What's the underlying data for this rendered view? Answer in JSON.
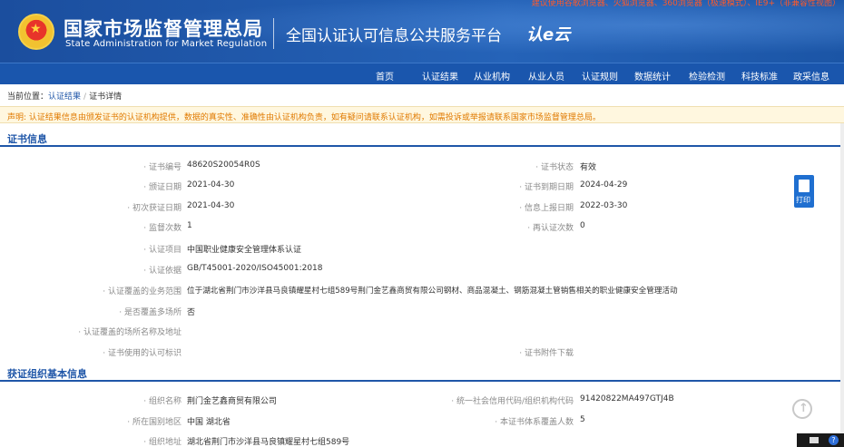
{
  "header": {
    "top_notice": "建议使用谷歌浏览器、火狐浏览器、360浏览器（极速模式）、IE9+（非兼容性视图）",
    "title_cn": "国家市场监督管理总局",
    "title_en": "State Administration  for  Market Regulation",
    "platform": "全国认证认可信息公共服务平台",
    "logo_text": "认e云"
  },
  "nav": {
    "items": [
      "首页",
      "认证结果",
      "从业机构",
      "从业人员",
      "认证规则",
      "数据统计",
      "检验检测",
      "科技标准",
      "政采信息"
    ]
  },
  "breadcrumb": {
    "prefix": "当前位置：",
    "item1": "认证结果",
    "sep": "/",
    "item2": "证书详情"
  },
  "notice": "声明: 认证结果信息由颁发证书的认证机构提供，数据的真实性、准确性由认证机构负责，如有疑问请联系认证机构，如需投诉或举报请联系国家市场监督管理总局。",
  "cert": {
    "section_title": "证书信息",
    "cert_no_label": "· 证书编号",
    "cert_no": "48620S20054R0S",
    "status_label": "· 证书状态",
    "status": "有效",
    "issue_date_label": "· 颁证日期",
    "issue_date": "2021-04-30",
    "expire_date_label": "· 证书到期日期",
    "expire_date": "2024-04-29",
    "first_date_label": "· 初次获证日期",
    "first_date": "2021-04-30",
    "report_date_label": "· 信息上报日期",
    "report_date": "2022-03-30",
    "supervision_label": "· 监督次数",
    "supervision": "1",
    "recert_label": "· 再认证次数",
    "recert": "0",
    "project_label": "· 认证项目",
    "project": "中国职业健康安全管理体系认证",
    "basis_label": "· 认证依据",
    "basis": "GB/T45001-2020/ISO45001:2018",
    "scope_label": "· 认证覆盖的业务范围",
    "scope": "位于湖北省荆门市沙洋县马良镇耀星村七组589号荆门金艺鑫商贸有限公司钢材、商品混凝土、钢筋混凝土管销售相关的职业健康安全管理活动",
    "multisite_label": "· 是否覆盖多场所",
    "multisite": "否",
    "site_names_label": "· 认证覆盖的场所名称及地址",
    "mark_label": "· 证书使用的认可标识",
    "attachment_label": "· 证书附件下载"
  },
  "org": {
    "section_title": "获证组织基本信息",
    "name_label": "· 组织名称",
    "name": "荆门金艺鑫商贸有限公司",
    "credit_label": "· 统一社会信用代码/组织机构代码",
    "credit": "91420822MA497GTJ4B",
    "region_label": "· 所在国别地区",
    "region": "中国 湖北省",
    "people_label": "· 本证书体系覆盖人数",
    "people": "5",
    "address_label": "· 组织地址",
    "address": "湖北省荆门市沙洋县马良镇耀星村七组589号"
  },
  "print_label": "打印",
  "colors": {
    "brand": "#1f56a8",
    "notice": "#e07a00",
    "label": "#8a8a8a"
  }
}
